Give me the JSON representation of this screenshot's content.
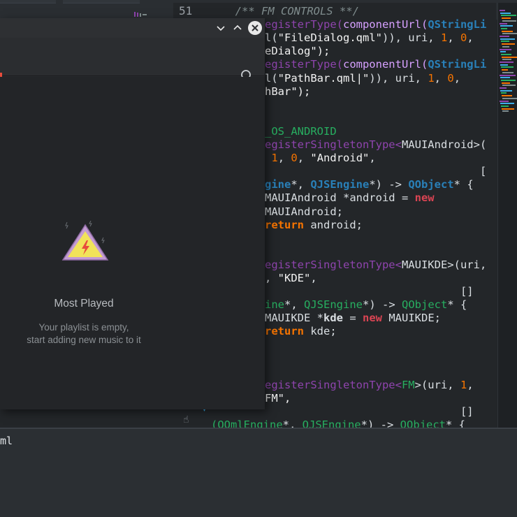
{
  "editor": {
    "line_number": "51",
    "code_lines": [
      {
        "parts": [
          {
            "t": "  /** FM CONTROLS **/",
            "c": "c-comment"
          }
        ]
      },
      {
        "parts": [
          {
            "t": "egisterType(",
            "c": "c-fn"
          },
          {
            "t": "componentUrl(",
            "c": "c-fn2"
          },
          {
            "t": "QStringLi",
            "c": "c-type"
          }
        ]
      },
      {
        "parts": [
          {
            "t": "l(",
            "c": "c-punct"
          },
          {
            "t": "\"FileDialog.qml\"",
            "c": "c-str"
          },
          {
            "t": ")), uri, ",
            "c": "c-punct"
          },
          {
            "t": "1",
            "c": "c-num"
          },
          {
            "t": ", ",
            "c": "c-punct"
          },
          {
            "t": "0",
            "c": "c-num"
          },
          {
            "t": ",",
            "c": "c-punct"
          }
        ]
      },
      {
        "parts": [
          {
            "t": "eDialog\");",
            "c": "c-str"
          }
        ]
      },
      {
        "parts": [
          {
            "t": "egisterType(",
            "c": "c-fn"
          },
          {
            "t": "componentUrl(",
            "c": "c-fn2"
          },
          {
            "t": "QStringLi",
            "c": "c-type"
          }
        ]
      },
      {
        "parts": [
          {
            "t": "l(",
            "c": "c-punct"
          },
          {
            "t": "\"PathBar.qml|\"",
            "c": "c-str"
          },
          {
            "t": ")), uri, ",
            "c": "c-punct"
          },
          {
            "t": "1",
            "c": "c-num"
          },
          {
            "t": ", ",
            "c": "c-punct"
          },
          {
            "t": "0",
            "c": "c-num"
          },
          {
            "t": ",",
            "c": "c-punct"
          }
        ]
      },
      {
        "parts": [
          {
            "t": "hBar\");",
            "c": "c-str"
          }
        ]
      },
      {
        "parts": [
          {
            "t": "",
            "c": "c-punct"
          }
        ]
      },
      {
        "parts": [
          {
            "t": "",
            "c": "c-punct"
          }
        ]
      },
      {
        "parts": [
          {
            "t": "_OS_ANDROID",
            "c": "c-green"
          }
        ]
      },
      {
        "parts": [
          {
            "t": "egisterSingletonType<",
            "c": "c-fn"
          },
          {
            "t": "MAUIAndroid",
            "c": "c-punct"
          },
          {
            "t": ">(",
            "c": "c-punct"
          }
        ]
      },
      {
        "parts": [
          {
            "t": " ",
            "c": "c-punct"
          },
          {
            "t": "1",
            "c": "c-num"
          },
          {
            "t": ", ",
            "c": "c-punct"
          },
          {
            "t": "0",
            "c": "c-num"
          },
          {
            "t": ", ",
            "c": "c-punct"
          },
          {
            "t": "\"Android\"",
            "c": "c-str"
          },
          {
            "t": ",",
            "c": "c-punct"
          }
        ]
      },
      {
        "parts": [
          {
            "t": "                                 [",
            "c": "c-punct"
          }
        ]
      },
      {
        "parts": [
          {
            "t": "gine",
            "c": "c-type"
          },
          {
            "t": "*, ",
            "c": "c-punct"
          },
          {
            "t": "QJSEngine",
            "c": "c-type"
          },
          {
            "t": "*) -> ",
            "c": "c-punct"
          },
          {
            "t": "QObject",
            "c": "c-type"
          },
          {
            "t": "* {",
            "c": "c-punct"
          }
        ]
      },
      {
        "parts": [
          {
            "t": "MAUIAndroid *android = ",
            "c": "c-punct"
          },
          {
            "t": "new",
            "c": "c-kw"
          }
        ]
      },
      {
        "parts": [
          {
            "t": "MAUIAndroid;",
            "c": "c-punct"
          }
        ]
      },
      {
        "parts": [
          {
            "t": "return",
            "c": "c-kw2"
          },
          {
            "t": " android;",
            "c": "c-punct"
          }
        ]
      },
      {
        "parts": [
          {
            "t": "",
            "c": "c-punct"
          }
        ]
      },
      {
        "parts": [
          {
            "t": "",
            "c": "c-punct"
          }
        ]
      },
      {
        "parts": [
          {
            "t": "egisterSingletonType<",
            "c": "c-fn"
          },
          {
            "t": "MAUIKDE",
            "c": "c-punct"
          },
          {
            "t": ">(uri,",
            "c": "c-punct"
          }
        ]
      },
      {
        "parts": [
          {
            "t": ", ",
            "c": "c-punct"
          },
          {
            "t": "\"KDE\"",
            "c": "c-str"
          },
          {
            "t": ",",
            "c": "c-punct"
          }
        ]
      },
      {
        "parts": [
          {
            "t": "                              []",
            "c": "c-punct"
          }
        ]
      },
      {
        "parts": [
          {
            "t": "ine",
            "c": "c-green"
          },
          {
            "t": "*, ",
            "c": "c-punct"
          },
          {
            "t": "QJSEngine",
            "c": "c-green"
          },
          {
            "t": "*) -> ",
            "c": "c-punct"
          },
          {
            "t": "QObject",
            "c": "c-green"
          },
          {
            "t": "* {",
            "c": "c-punct"
          }
        ]
      },
      {
        "parts": [
          {
            "t": "MAUIKDE *",
            "c": "c-punct"
          },
          {
            "t": "kde",
            "c": "c-bold"
          },
          {
            "t": " = ",
            "c": "c-punct"
          },
          {
            "t": "new",
            "c": "c-kw"
          },
          {
            "t": " MAUIKDE;",
            "c": "c-punct"
          }
        ]
      },
      {
        "parts": [
          {
            "t": "return",
            "c": "c-kw2"
          },
          {
            "t": " kde;",
            "c": "c-punct"
          }
        ]
      },
      {
        "parts": [
          {
            "t": "",
            "c": "c-punct"
          }
        ]
      },
      {
        "parts": [
          {
            "t": "",
            "c": "c-punct"
          }
        ]
      },
      {
        "parts": [
          {
            "t": "",
            "c": "c-punct"
          }
        ]
      },
      {
        "parts": [
          {
            "t": "egisterSingletonType<",
            "c": "c-fn"
          },
          {
            "t": "FM",
            "c": "c-green"
          },
          {
            "t": ">(uri, ",
            "c": "c-punct"
          },
          {
            "t": "1",
            "c": "c-num"
          },
          {
            "t": ",",
            "c": "c-punct"
          }
        ]
      },
      {
        "parts": [
          {
            "t": "FM\",",
            "c": "c-str"
          }
        ]
      },
      {
        "parts": [
          {
            "t": "                              []",
            "c": "c-punct"
          }
        ]
      },
      {
        "parts": [
          {
            "t": "(QQmlEngine",
            "c": "c-green"
          },
          {
            "t": "*, ",
            "c": "c-punct"
          },
          {
            "t": "QJSEngine",
            "c": "c-green"
          },
          {
            "t": "*) -> ",
            "c": "c-punct"
          },
          {
            "t": "QObject",
            "c": "c-green"
          },
          {
            "t": "* {",
            "c": "c-punct"
          }
        ]
      }
    ],
    "bottom_panel_text": "ml"
  },
  "player": {
    "empty_title": "Most Played",
    "empty_line1": "Your playlist is empty,",
    "empty_line2": "start adding new music to it"
  },
  "icons": {
    "window_collapse": "chevron-down-icon",
    "window_expand": "chevron-up-icon",
    "window_close": "close-icon",
    "search": "search-icon",
    "empty_state": "warning-lightning-icon"
  },
  "colors": {
    "accent_red": "#e74c3c",
    "warning_yellow": "#f1e35a",
    "warning_purple": "#c39bd3"
  }
}
